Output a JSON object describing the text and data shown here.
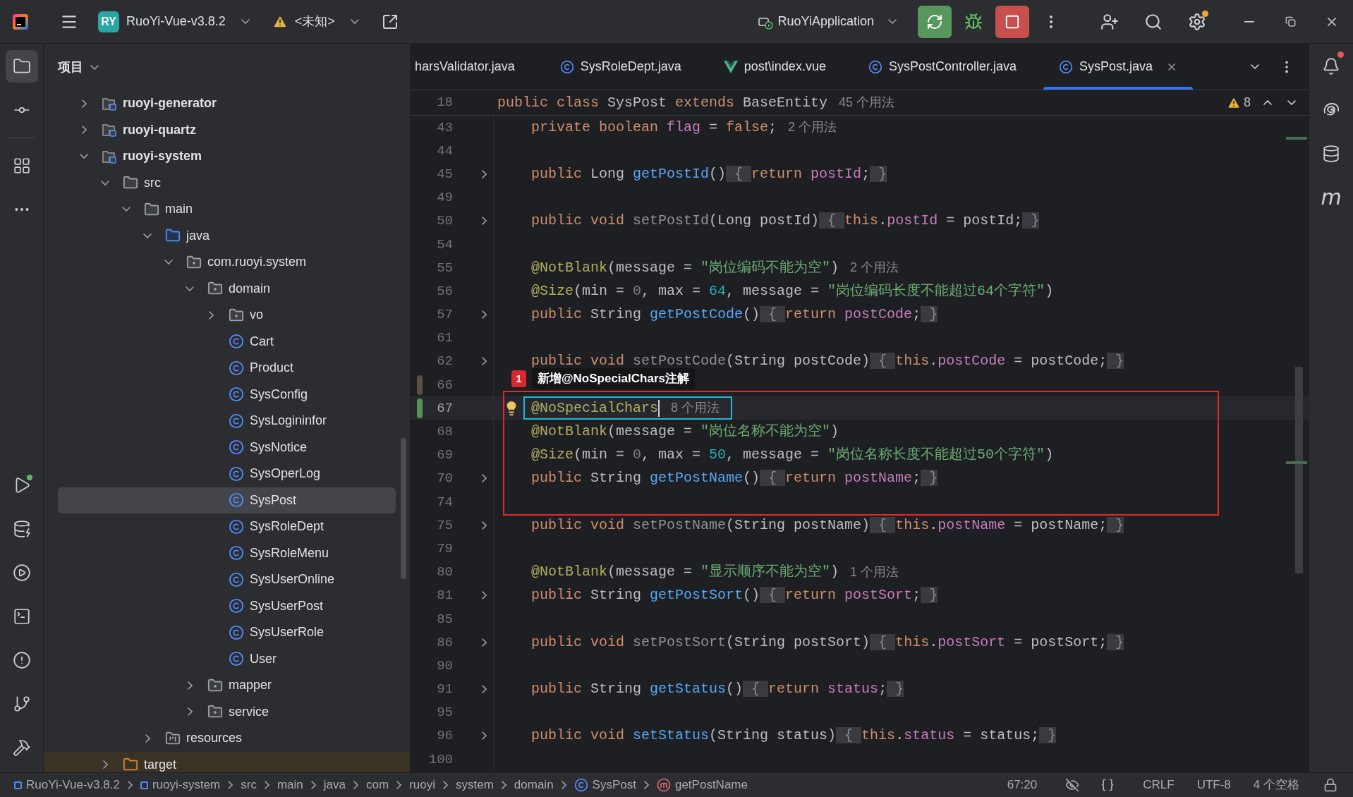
{
  "title_bar": {
    "project": {
      "badge": "RY",
      "name": "RuoYi-Vue-v3.8.2"
    },
    "vcs": {
      "label": "<未知>"
    },
    "run_config": {
      "label": "RuoYiApplication"
    },
    "update_available": true
  },
  "left_toolbar": {
    "top": [
      {
        "kind": "project",
        "selected": true
      },
      {
        "kind": "commit",
        "selected": false
      },
      {
        "kind": "structure",
        "selected": false
      },
      {
        "kind": "more",
        "selected": false
      }
    ],
    "bottom": [
      {
        "kind": "run",
        "selected": false,
        "running": true
      },
      {
        "kind": "database",
        "selected": false
      },
      {
        "kind": "services",
        "selected": false
      },
      {
        "kind": "terminal",
        "selected": false
      },
      {
        "kind": "problems",
        "selected": false
      },
      {
        "kind": "git",
        "selected": false
      },
      {
        "kind": "build",
        "selected": false
      }
    ]
  },
  "right_toolbar": [
    {
      "kind": "notifications",
      "unread": true
    },
    {
      "kind": "ai"
    },
    {
      "kind": "database"
    },
    {
      "kind": "maven",
      "label": "m"
    }
  ],
  "project_tree": {
    "title": "项目",
    "items": [
      {
        "label": "ruoyi-generator",
        "kind": "module",
        "expanded": false,
        "selected": false
      },
      {
        "label": "ruoyi-quartz",
        "kind": "module",
        "expanded": false,
        "selected": false
      },
      {
        "label": "ruoyi-system",
        "kind": "module",
        "expanded": true,
        "selected": false,
        "children": [
          {
            "label": "src",
            "kind": "folder",
            "expanded": true,
            "selected": false,
            "children": [
              {
                "label": "main",
                "kind": "folder",
                "expanded": true,
                "selected": false,
                "children": [
                  {
                    "label": "java",
                    "kind": "source",
                    "expanded": true,
                    "selected": false,
                    "children": [
                      {
                        "label": "com.ruoyi.system",
                        "kind": "package",
                        "expanded": true,
                        "selected": false,
                        "children": [
                          {
                            "label": "domain",
                            "kind": "package",
                            "expanded": true,
                            "selected": false,
                            "children": [
                              {
                                "label": "vo",
                                "kind": "package",
                                "expanded": false,
                                "selected": false
                              },
                              {
                                "label": "Cart",
                                "kind": "class",
                                "selected": false
                              },
                              {
                                "label": "Product",
                                "kind": "class",
                                "selected": false
                              },
                              {
                                "label": "SysConfig",
                                "kind": "class",
                                "selected": false
                              },
                              {
                                "label": "SysLogininfor",
                                "kind": "class",
                                "selected": false
                              },
                              {
                                "label": "SysNotice",
                                "kind": "class",
                                "selected": false
                              },
                              {
                                "label": "SysOperLog",
                                "kind": "class",
                                "selected": false
                              },
                              {
                                "label": "SysPost",
                                "kind": "class",
                                "selected": true
                              },
                              {
                                "label": "SysRoleDept",
                                "kind": "class",
                                "selected": false
                              },
                              {
                                "label": "SysRoleMenu",
                                "kind": "class",
                                "selected": false
                              },
                              {
                                "label": "SysUserOnline",
                                "kind": "class",
                                "selected": false
                              },
                              {
                                "label": "SysUserPost",
                                "kind": "class",
                                "selected": false
                              },
                              {
                                "label": "SysUserRole",
                                "kind": "class",
                                "selected": false
                              },
                              {
                                "label": "User",
                                "kind": "class",
                                "selected": false
                              }
                            ]
                          },
                          {
                            "label": "mapper",
                            "kind": "package",
                            "expanded": false,
                            "selected": false
                          },
                          {
                            "label": "service",
                            "kind": "package",
                            "expanded": false,
                            "selected": false
                          }
                        ]
                      }
                    ]
                  },
                  {
                    "label": "resources",
                    "kind": "resources",
                    "expanded": false,
                    "selected": false
                  }
                ]
              }
            ]
          },
          {
            "label": "target",
            "kind": "excluded",
            "expanded": false,
            "selected": false
          }
        ]
      }
    ]
  },
  "tabs": [
    {
      "label": "harsValidator.java",
      "kind": "cut",
      "selected": false
    },
    {
      "label": "SysRoleDept.java",
      "kind": "class",
      "selected": false
    },
    {
      "label": "post\\index.vue",
      "kind": "vue",
      "selected": false
    },
    {
      "label": "SysPostController.java",
      "kind": "class",
      "selected": false
    },
    {
      "label": "SysPost.java",
      "kind": "class",
      "selected": true
    }
  ],
  "editor": {
    "sticky": {
      "number": "18",
      "tokens": [
        {
          "text": "public class ",
          "kind": "k"
        },
        {
          "text": "SysPost ",
          "kind": "t"
        },
        {
          "text": "extends ",
          "kind": "k"
        },
        {
          "text": "BaseEntity",
          "kind": "t"
        }
      ],
      "hint": "45 个用法"
    },
    "warnings": "8",
    "lines": [
      {
        "number": "43",
        "indented": true,
        "tokens": [
          {
            "text": "private boolean ",
            "kind": "k"
          },
          {
            "text": "flag",
            "kind": "v"
          },
          {
            "text": " = ",
            "kind": "t"
          },
          {
            "text": "false",
            "kind": "k"
          },
          {
            "text": ";",
            "kind": "t"
          }
        ],
        "hint": "2 个用法"
      },
      {
        "number": "44"
      },
      {
        "number": "45",
        "indented": true,
        "folded": true,
        "tokens": [
          {
            "text": "public ",
            "kind": "k"
          },
          {
            "text": "Long ",
            "kind": "t"
          },
          {
            "text": "getPostId",
            "kind": "f"
          },
          {
            "text": "()",
            "kind": "t"
          },
          {
            "text": " { ",
            "kind": "o"
          },
          {
            "text": "return ",
            "kind": "k"
          },
          {
            "text": "postId",
            "kind": "v"
          },
          {
            "text": ";",
            "kind": "t"
          },
          {
            "text": " }",
            "kind": "o"
          }
        ]
      },
      {
        "number": "49"
      },
      {
        "number": "50",
        "indented": true,
        "folded": true,
        "tokens": [
          {
            "text": "public void ",
            "kind": "k"
          },
          {
            "text": "setPostId",
            "kind": "u"
          },
          {
            "text": "(Long postId)",
            "kind": "t"
          },
          {
            "text": " { ",
            "kind": "o"
          },
          {
            "text": "this",
            "kind": "k"
          },
          {
            "text": ".",
            "kind": "t"
          },
          {
            "text": "postId",
            "kind": "v"
          },
          {
            "text": " = postId;",
            "kind": "t"
          },
          {
            "text": " }",
            "kind": "o"
          }
        ]
      },
      {
        "number": "54"
      },
      {
        "number": "55",
        "indented": true,
        "tokens": [
          {
            "text": "@NotBlank",
            "kind": "a"
          },
          {
            "text": "(message = ",
            "kind": "t"
          },
          {
            "text": "\"岗位编码不能为空\"",
            "kind": "s"
          },
          {
            "text": ")",
            "kind": "t"
          }
        ],
        "hint": "2 个用法"
      },
      {
        "number": "56",
        "indented": true,
        "tokens": [
          {
            "text": "@Size",
            "kind": "a"
          },
          {
            "text": "(min = ",
            "kind": "t"
          },
          {
            "text": "0",
            "kind": "z"
          },
          {
            "text": ", max = ",
            "kind": "t"
          },
          {
            "text": "64",
            "kind": "n"
          },
          {
            "text": ", message = ",
            "kind": "t"
          },
          {
            "text": "\"岗位编码长度不能超过64个字符\"",
            "kind": "s"
          },
          {
            "text": ")",
            "kind": "t"
          }
        ]
      },
      {
        "number": "57",
        "indented": true,
        "folded": true,
        "tokens": [
          {
            "text": "public ",
            "kind": "k"
          },
          {
            "text": "String ",
            "kind": "t"
          },
          {
            "text": "getPostCode",
            "kind": "f"
          },
          {
            "text": "()",
            "kind": "t"
          },
          {
            "text": " { ",
            "kind": "o"
          },
          {
            "text": "return ",
            "kind": "k"
          },
          {
            "text": "postCode",
            "kind": "v"
          },
          {
            "text": ";",
            "kind": "t"
          },
          {
            "text": " }",
            "kind": "o"
          }
        ]
      },
      {
        "number": "61"
      },
      {
        "number": "62",
        "indented": true,
        "folded": true,
        "tokens": [
          {
            "text": "public void ",
            "kind": "k"
          },
          {
            "text": "setPostCode",
            "kind": "u"
          },
          {
            "text": "(String postCode)",
            "kind": "t"
          },
          {
            "text": " { ",
            "kind": "o"
          },
          {
            "text": "this",
            "kind": "k"
          },
          {
            "text": ".",
            "kind": "t"
          },
          {
            "text": "postCode",
            "kind": "v"
          },
          {
            "text": " = postCode;",
            "kind": "t"
          },
          {
            "text": " }",
            "kind": "o"
          }
        ]
      },
      {
        "number": "66",
        "modified": true
      },
      {
        "number": "67",
        "indented": true,
        "added": true,
        "current": true,
        "boxed": true,
        "intention": true,
        "caret": true,
        "tokens": [
          {
            "text": "@NoSpecialChars",
            "kind": "a"
          }
        ],
        "hint": "8 个用法"
      },
      {
        "number": "68",
        "indented": true,
        "tokens": [
          {
            "text": "@NotBlank",
            "kind": "a"
          },
          {
            "text": "(message = ",
            "kind": "t"
          },
          {
            "text": "\"岗位名称不能为空\"",
            "kind": "s"
          },
          {
            "text": ")",
            "kind": "t"
          }
        ]
      },
      {
        "number": "69",
        "indented": true,
        "tokens": [
          {
            "text": "@Size",
            "kind": "a"
          },
          {
            "text": "(min = ",
            "kind": "t"
          },
          {
            "text": "0",
            "kind": "z"
          },
          {
            "text": ", max = ",
            "kind": "t"
          },
          {
            "text": "50",
            "kind": "n"
          },
          {
            "text": ", message = ",
            "kind": "t"
          },
          {
            "text": "\"岗位名称长度不能超过50个字符\"",
            "kind": "s"
          },
          {
            "text": ")",
            "kind": "t"
          }
        ]
      },
      {
        "number": "70",
        "indented": true,
        "folded": true,
        "tokens": [
          {
            "text": "public ",
            "kind": "k"
          },
          {
            "text": "String ",
            "kind": "t"
          },
          {
            "text": "getPostName",
            "kind": "f"
          },
          {
            "text": "()",
            "kind": "t"
          },
          {
            "text": " { ",
            "kind": "o"
          },
          {
            "text": "return ",
            "kind": "k"
          },
          {
            "text": "postName",
            "kind": "v"
          },
          {
            "text": ";",
            "kind": "t"
          },
          {
            "text": " }",
            "kind": "o"
          }
        ]
      },
      {
        "number": "74"
      },
      {
        "number": "75",
        "indented": true,
        "folded": true,
        "tokens": [
          {
            "text": "public void ",
            "kind": "k"
          },
          {
            "text": "setPostName",
            "kind": "u"
          },
          {
            "text": "(String postName)",
            "kind": "t"
          },
          {
            "text": " { ",
            "kind": "o"
          },
          {
            "text": "this",
            "kind": "k"
          },
          {
            "text": ".",
            "kind": "t"
          },
          {
            "text": "postName",
            "kind": "v"
          },
          {
            "text": " = postName;",
            "kind": "t"
          },
          {
            "text": " }",
            "kind": "o"
          }
        ]
      },
      {
        "number": "79"
      },
      {
        "number": "80",
        "indented": true,
        "tokens": [
          {
            "text": "@NotBlank",
            "kind": "a"
          },
          {
            "text": "(message = ",
            "kind": "t"
          },
          {
            "text": "\"显示顺序不能为空\"",
            "kind": "s"
          },
          {
            "text": ")",
            "kind": "t"
          }
        ],
        "hint": "1 个用法"
      },
      {
        "number": "81",
        "indented": true,
        "folded": true,
        "tokens": [
          {
            "text": "public ",
            "kind": "k"
          },
          {
            "text": "String ",
            "kind": "t"
          },
          {
            "text": "getPostSort",
            "kind": "f"
          },
          {
            "text": "()",
            "kind": "t"
          },
          {
            "text": " { ",
            "kind": "o"
          },
          {
            "text": "return ",
            "kind": "k"
          },
          {
            "text": "postSort",
            "kind": "v"
          },
          {
            "text": ";",
            "kind": "t"
          },
          {
            "text": " }",
            "kind": "o"
          }
        ]
      },
      {
        "number": "85"
      },
      {
        "number": "86",
        "indented": true,
        "folded": true,
        "tokens": [
          {
            "text": "public void ",
            "kind": "k"
          },
          {
            "text": "setPostSort",
            "kind": "u"
          },
          {
            "text": "(String postSort)",
            "kind": "t"
          },
          {
            "text": " { ",
            "kind": "o"
          },
          {
            "text": "this",
            "kind": "k"
          },
          {
            "text": ".",
            "kind": "t"
          },
          {
            "text": "postSort",
            "kind": "v"
          },
          {
            "text": " = postSort;",
            "kind": "t"
          },
          {
            "text": " }",
            "kind": "o"
          }
        ]
      },
      {
        "number": "90"
      },
      {
        "number": "91",
        "indented": true,
        "folded": true,
        "tokens": [
          {
            "text": "public ",
            "kind": "k"
          },
          {
            "text": "String ",
            "kind": "t"
          },
          {
            "text": "getStatus",
            "kind": "f"
          },
          {
            "text": "()",
            "kind": "t"
          },
          {
            "text": " { ",
            "kind": "o"
          },
          {
            "text": "return ",
            "kind": "k"
          },
          {
            "text": "status",
            "kind": "v"
          },
          {
            "text": ";",
            "kind": "t"
          },
          {
            "text": " }",
            "kind": "o"
          }
        ]
      },
      {
        "number": "95"
      },
      {
        "number": "96",
        "indented": true,
        "folded": true,
        "tokens": [
          {
            "text": "public void ",
            "kind": "k"
          },
          {
            "text": "setStatus",
            "kind": "f"
          },
          {
            "text": "(String status)",
            "kind": "t"
          },
          {
            "text": " { ",
            "kind": "o"
          },
          {
            "text": "this",
            "kind": "k"
          },
          {
            "text": ".",
            "kind": "t"
          },
          {
            "text": "status",
            "kind": "v"
          },
          {
            "text": " = status;",
            "kind": "t"
          },
          {
            "text": " }",
            "kind": "o"
          }
        ]
      },
      {
        "number": "100"
      }
    ],
    "callout": {
      "number": "1",
      "text": "新增@NoSpecialChars注解"
    }
  },
  "status_bar": {
    "breadcrumbs": [
      {
        "label": "RuoYi-Vue-v3.8.2",
        "kind": "module"
      },
      {
        "label": "ruoyi-system",
        "kind": "module"
      },
      {
        "label": "src",
        "kind": "plain"
      },
      {
        "label": "main",
        "kind": "plain"
      },
      {
        "label": "java",
        "kind": "plain"
      },
      {
        "label": "com",
        "kind": "plain"
      },
      {
        "label": "ruoyi",
        "kind": "plain"
      },
      {
        "label": "system",
        "kind": "plain"
      },
      {
        "label": "domain",
        "kind": "plain"
      },
      {
        "label": "SysPost",
        "kind": "class"
      },
      {
        "label": "getPostName",
        "kind": "method"
      }
    ],
    "position": "67:20",
    "line_separator": "CRLF",
    "encoding": "UTF-8",
    "indent": "4 个空格"
  }
}
